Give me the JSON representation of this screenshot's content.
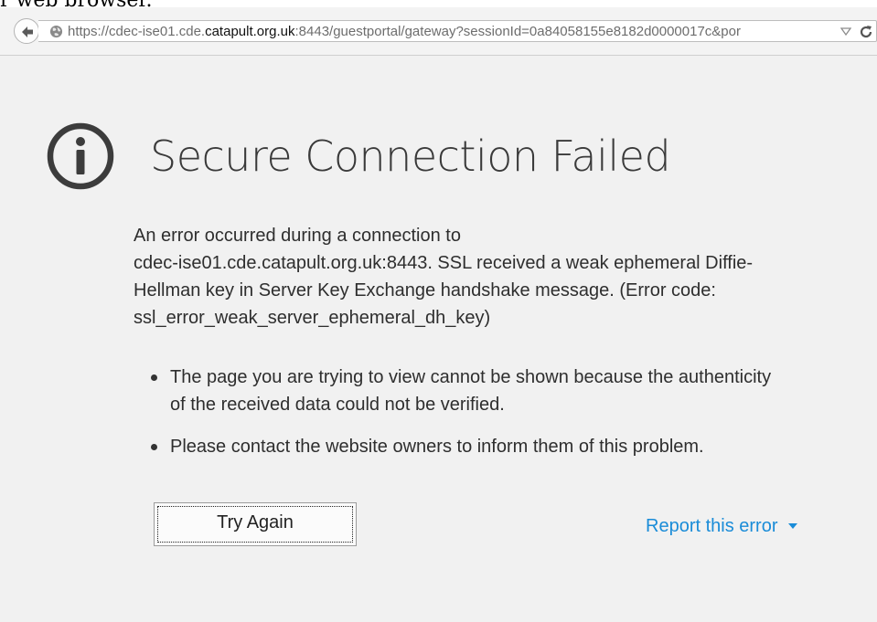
{
  "caption": "r web browser.",
  "browser": {
    "url_prefix": "https://cdec-ise01.cde.",
    "url_host": "catapult.org.uk",
    "url_suffix": ":8443/guestportal/gateway?sessionId=0a84058155e8182d0000017c&por",
    "icons": {
      "back": "back-arrow-icon",
      "site": "globe-icon",
      "dropmarker": "dropdown-triangle-icon",
      "reload": "reload-icon"
    }
  },
  "error_page": {
    "icon": "info-icon",
    "title": "Secure Connection Failed",
    "message_lines": [
      "An error occurred during a connection to",
      "cdec-ise01.cde.catapult.org.uk:8443. SSL received a weak ephemeral Diffie-",
      "Hellman key in Server Key Exchange handshake message. (Error code:",
      "ssl_error_weak_server_ephemeral_dh_key)"
    ],
    "bullets": [
      {
        "line1": "The page you are trying to view cannot be shown because the authenticity",
        "line2": "of the received data could not be verified."
      },
      {
        "line1": "Please contact the website owners to inform them of this problem.",
        "line2": ""
      }
    ],
    "try_again_label": "Try Again",
    "report_label": "Report this error",
    "colors": {
      "link": "#1a8cd8",
      "title": "#3a3a3a",
      "page_background": "#f1f1f1"
    }
  }
}
